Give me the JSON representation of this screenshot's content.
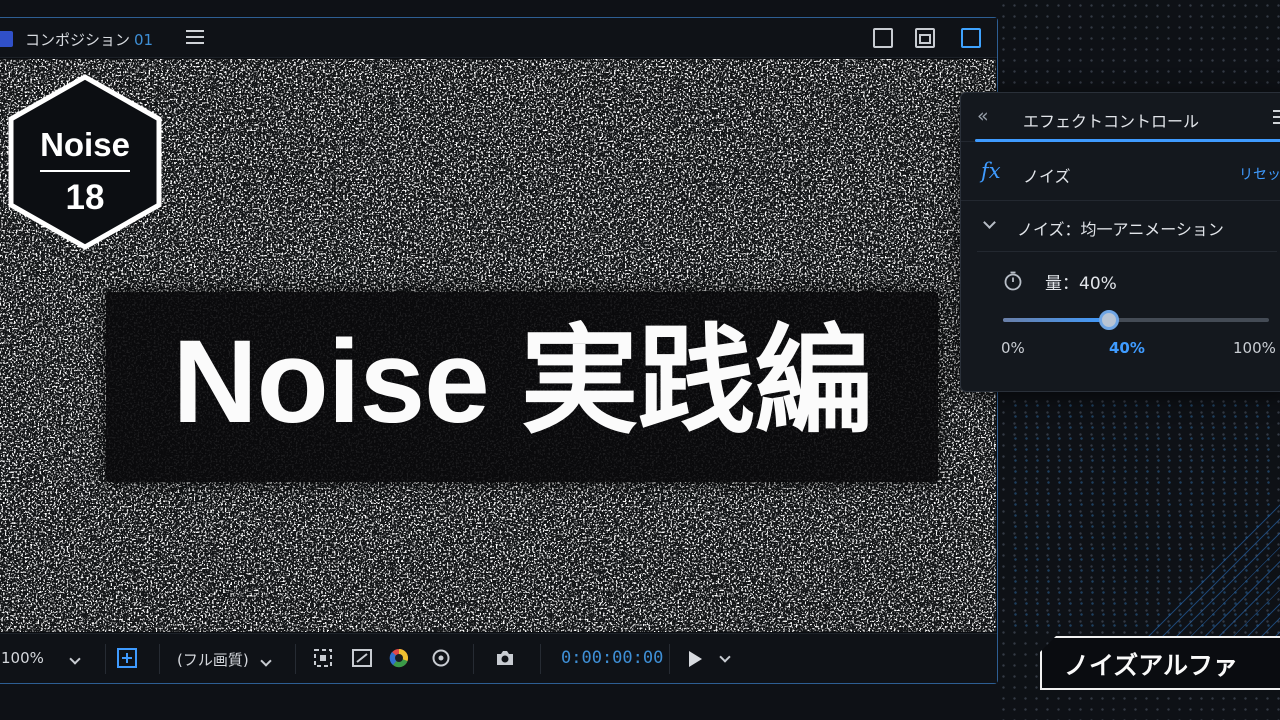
{
  "composition": {
    "title": "コンポジション",
    "number": "01",
    "swatch_color": "#3050c8",
    "accent_color": "#3f9bff"
  },
  "badge": {
    "line1": "Noise",
    "line2": "18"
  },
  "viewer": {
    "headline": "Noise 実践編"
  },
  "toolbar": {
    "zoom": "100%",
    "quality": "(フル画質)",
    "timecode": "0:00:00:00"
  },
  "effect_controls": {
    "panel_title": "エフェクトコントロール",
    "effect_name": "ノイズ",
    "reset_label": "リセット",
    "mode_label": "ノイズ：均一アニメーション",
    "amount_label": "量：40%",
    "amount_value": 0.4,
    "slider_ticks": [
      "0%",
      "40%",
      "100%"
    ]
  },
  "footer_label": "ノイズアルファ"
}
